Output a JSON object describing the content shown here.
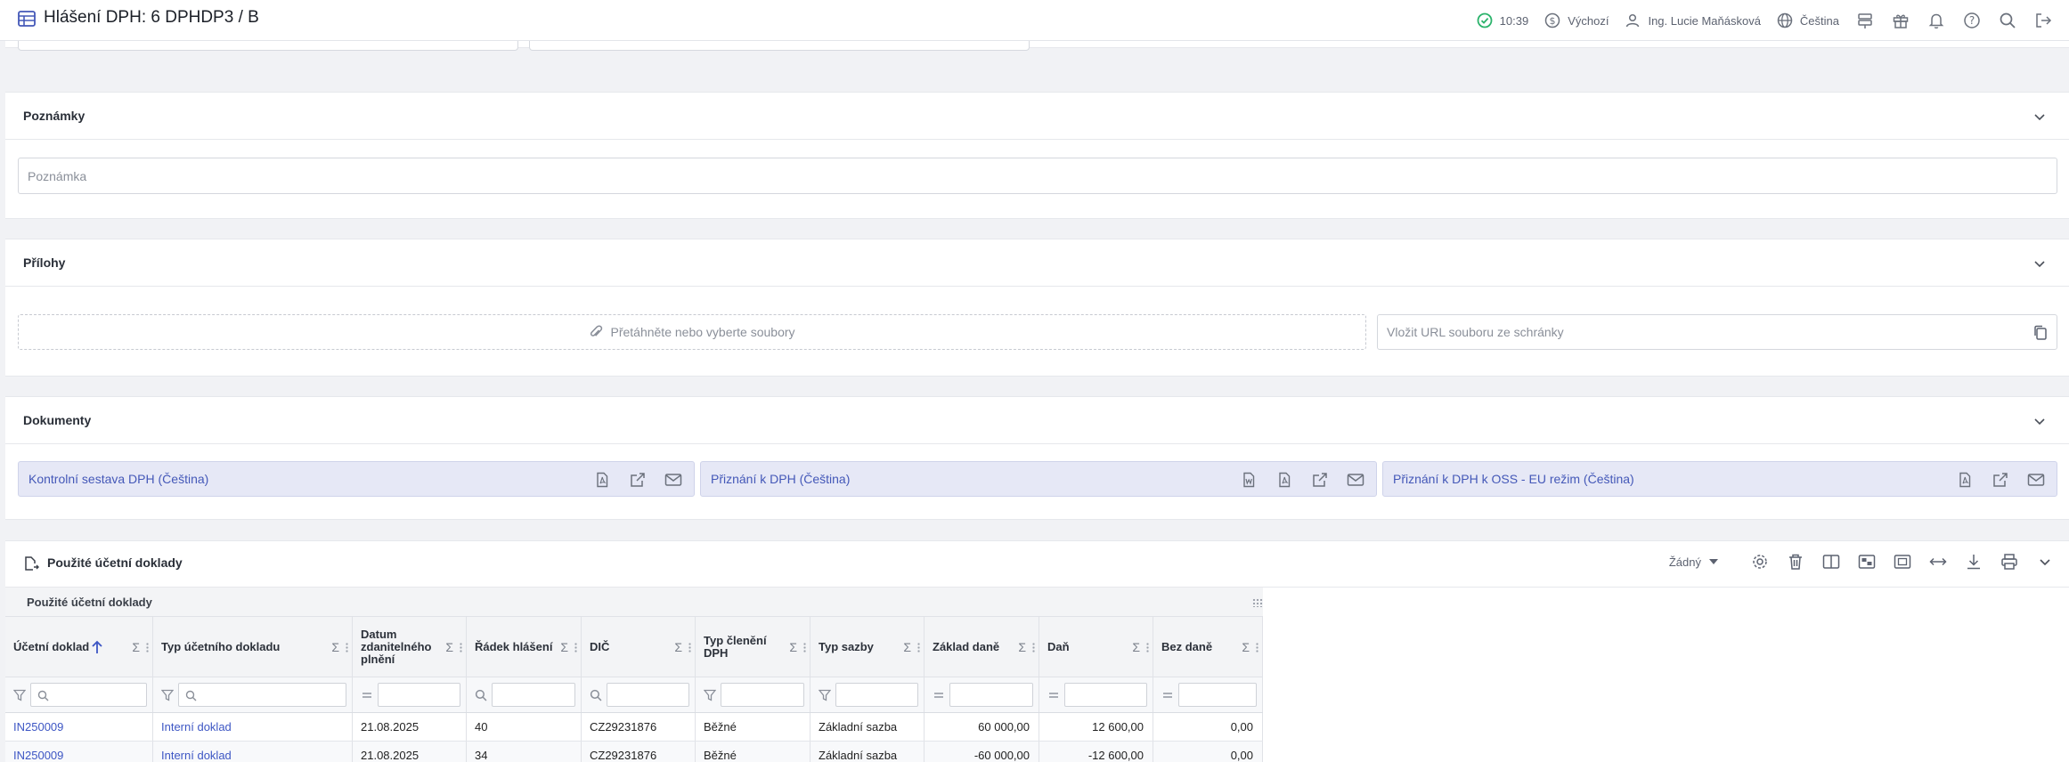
{
  "header": {
    "title": "Hlášení DPH: 6 DPHDP3 / B",
    "time": "10:39",
    "currency": "Výchozí",
    "user": "Ing. Lucie Maňásková",
    "language": "Čeština"
  },
  "notes": {
    "title": "Poznámky",
    "placeholder": "Poznámka"
  },
  "attachments": {
    "title": "Přílohy",
    "dropzone": "Přetáhněte nebo vyberte soubory",
    "url_placeholder": "Vložit URL souboru ze schránky"
  },
  "documents": {
    "title": "Dokumenty",
    "items": [
      {
        "label": "Kontrolní sestava DPH (Čeština)"
      },
      {
        "label": "Přiznání k DPH (Čeština)"
      },
      {
        "label": "Přiznání k DPH k OSS - EU režim (Čeština)"
      }
    ]
  },
  "table": {
    "title": "Použité účetní doklady",
    "group_label": "Použité účetní doklady",
    "view_select": "Žádný",
    "columns": [
      {
        "label": "Účetní doklad"
      },
      {
        "label": "Typ účetního dokladu"
      },
      {
        "label": "Datum zdanitelného plnění"
      },
      {
        "label": "Řádek hlášení"
      },
      {
        "label": "DIČ"
      },
      {
        "label": "Typ členění DPH"
      },
      {
        "label": "Typ sazby"
      },
      {
        "label": "Základ daně"
      },
      {
        "label": "Daň"
      },
      {
        "label": "Bez daně"
      }
    ],
    "rows": [
      {
        "doc": "IN250009",
        "type": "Interní doklad",
        "date": "21.08.2025",
        "line": "40",
        "dic": "CZ29231876",
        "split": "Běžné",
        "rate": "Základní sazba",
        "base": "60 000,00",
        "tax": "12 600,00",
        "notax": "0,00"
      },
      {
        "doc": "IN250009",
        "type": "Interní doklad",
        "date": "21.08.2025",
        "line": "34",
        "dic": "CZ29231876",
        "split": "Běžné",
        "rate": "Základní sazba",
        "base": "-60 000,00",
        "tax": "-12 600,00",
        "notax": "0,00"
      }
    ]
  },
  "colors": {
    "accent": "#4458b8",
    "link": "#3d56c4",
    "success": "#2bb36b"
  }
}
